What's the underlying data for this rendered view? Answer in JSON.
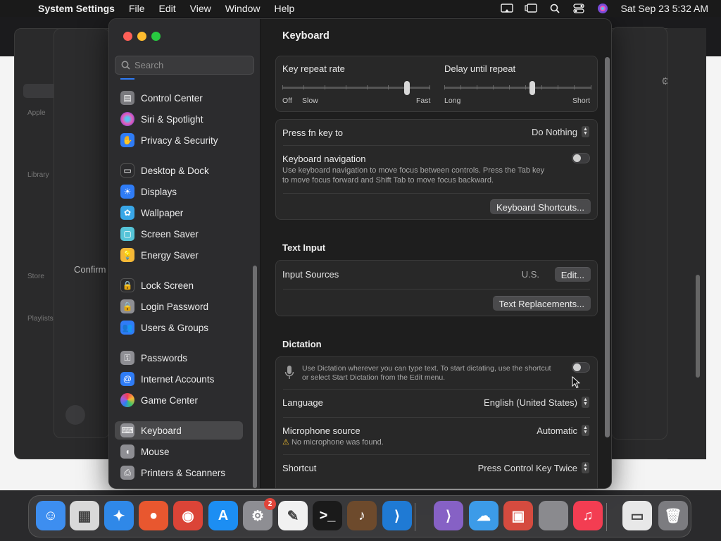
{
  "menubar": {
    "app_name": "System Settings",
    "menus": [
      "File",
      "Edit",
      "View",
      "Window",
      "Help"
    ],
    "clock": "Sat Sep 23  5:32 AM"
  },
  "background": {
    "confirm_text": "Confirm",
    "side_labels": [
      "Apple",
      "Library",
      "Store",
      "Playlists"
    ]
  },
  "search": {
    "placeholder": "Search"
  },
  "sidebar": {
    "items": [
      {
        "label": "Control Center",
        "icon": "control-center-icon",
        "color": "#7a7a7e"
      },
      {
        "label": "Siri & Spotlight",
        "icon": "siri-icon",
        "color": "#8a3fd1"
      },
      {
        "label": "Privacy & Security",
        "icon": "hand-icon",
        "color": "#2f7cf6"
      },
      {
        "label": "Desktop & Dock",
        "icon": "dock-icon",
        "color": "#2b2b2d"
      },
      {
        "label": "Displays",
        "icon": "sun-icon",
        "color": "#2f7cf6"
      },
      {
        "label": "Wallpaper",
        "icon": "flower-icon",
        "color": "#39a7e8"
      },
      {
        "label": "Screen Saver",
        "icon": "screen-saver-icon",
        "color": "#56c4d8"
      },
      {
        "label": "Energy Saver",
        "icon": "bulb-icon",
        "color": "#f5b836"
      },
      {
        "label": "Lock Screen",
        "icon": "lock-icon",
        "color": "#2b2b2d"
      },
      {
        "label": "Login Password",
        "icon": "lock-icon",
        "color": "#8e8e93"
      },
      {
        "label": "Users & Groups",
        "icon": "users-icon",
        "color": "#2f7cf6"
      },
      {
        "label": "Passwords",
        "icon": "key-icon",
        "color": "#8e8e93"
      },
      {
        "label": "Internet Accounts",
        "icon": "at-icon",
        "color": "#2f7cf6"
      },
      {
        "label": "Game Center",
        "icon": "game-center-icon",
        "color": "#e8e8e8"
      },
      {
        "label": "Keyboard",
        "icon": "keyboard-icon",
        "color": "#8e8e93"
      },
      {
        "label": "Mouse",
        "icon": "mouse-icon",
        "color": "#8e8e93"
      },
      {
        "label": "Printers & Scanners",
        "icon": "printer-icon",
        "color": "#8e8e93"
      }
    ]
  },
  "content": {
    "title": "Keyboard",
    "key_repeat": {
      "label": "Key repeat rate",
      "left_labels": [
        "Off",
        "Slow"
      ],
      "right_label": "Fast",
      "level": 0.83
    },
    "delay_repeat": {
      "label": "Delay until repeat",
      "left_label": "Long",
      "right_label": "Short",
      "level": 0.6
    },
    "fn_key": {
      "label": "Press fn key to",
      "value": "Do Nothing"
    },
    "keyboard_nav": {
      "label": "Keyboard navigation",
      "desc_line1": "Use keyboard navigation to move focus between controls. Press the Tab key",
      "desc_line2": "to move focus forward and Shift Tab to move focus backward.",
      "enabled": false
    },
    "shortcuts_button": "Keyboard Shortcuts...",
    "text_input": {
      "section": "Text Input",
      "input_sources_label": "Input Sources",
      "input_sources_value": "U.S.",
      "edit_button": "Edit...",
      "replacements_button": "Text Replacements..."
    },
    "dictation": {
      "section": "Dictation",
      "desc_line1": "Use Dictation wherever you can type text. To start dictating, use the shortcut",
      "desc_line2": "or select Start Dictation from the Edit menu.",
      "enabled": false,
      "language_label": "Language",
      "language_value": "English (United States)",
      "mic_label": "Microphone source",
      "mic_value": "Automatic",
      "mic_warning": "No microphone was found.",
      "shortcut_label": "Shortcut",
      "shortcut_value": "Press Control Key Twice"
    }
  },
  "dock": {
    "apps": [
      {
        "name": "Finder",
        "icon": "finder-icon",
        "color": "#3d8ef0",
        "glyph": "☺"
      },
      {
        "name": "Launchpad",
        "icon": "launchpad-icon",
        "color": "#d9d9d9",
        "glyph": "▦"
      },
      {
        "name": "Safari",
        "icon": "safari-icon",
        "color": "#2f88e8",
        "glyph": "✦"
      },
      {
        "name": "Firefox",
        "icon": "firefox-icon",
        "color": "#e8572f",
        "glyph": "●"
      },
      {
        "name": "Chrome",
        "icon": "chrome-icon",
        "color": "#db4437",
        "glyph": "◉"
      },
      {
        "name": "App Store",
        "icon": "app-store-icon",
        "color": "#1c8ef3",
        "glyph": "A"
      },
      {
        "name": "System Settings",
        "icon": "settings-icon",
        "color": "#8e8e93",
        "glyph": "⚙",
        "badge": "2"
      },
      {
        "name": "TextEdit",
        "icon": "textedit-icon",
        "color": "#f1f1f1",
        "glyph": "✎"
      },
      {
        "name": "Terminal",
        "icon": "terminal-icon",
        "color": "#1a1a1a",
        "glyph": ">_"
      },
      {
        "name": "GarageBand",
        "icon": "guitar-icon",
        "color": "#6d4a2c",
        "glyph": "♪"
      },
      {
        "name": "Visual Studio Code",
        "icon": "vscode-icon",
        "color": "#1f7ad4",
        "glyph": "⟩"
      },
      {
        "name": "Visual Studio",
        "icon": "visual-studio-icon",
        "color": "#8661c5",
        "glyph": "⟩"
      },
      {
        "name": "Weather",
        "icon": "weather-icon",
        "color": "#3c9be8",
        "glyph": "☁"
      },
      {
        "name": "Remote Desktop",
        "icon": "remote-desktop-icon",
        "color": "#d54b3f",
        "glyph": "▣"
      },
      {
        "name": "Apple",
        "icon": "apple-icon",
        "color": "#8a8a8e",
        "glyph": ""
      },
      {
        "name": "Music",
        "icon": "music-icon",
        "color": "#f33d52",
        "glyph": "♫"
      },
      {
        "name": "Preview Window",
        "icon": "window-icon",
        "color": "#e8e8e8",
        "glyph": "▭"
      },
      {
        "name": "Trash",
        "icon": "trash-icon",
        "color": "#7c7c80",
        "glyph": "🗑"
      }
    ]
  }
}
